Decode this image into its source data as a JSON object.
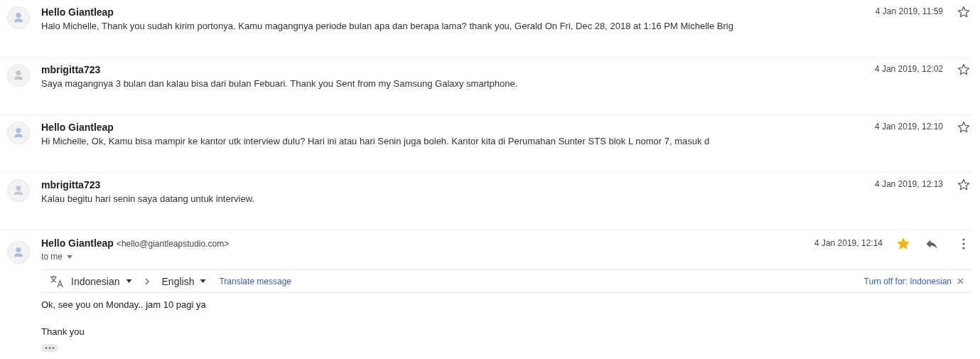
{
  "messages": [
    {
      "sender": "Hello Giantleap",
      "color": "#a8bde3",
      "snippet": "Halo Michelle, Thank you sudah kirim portonya. Kamu magangnya periode bulan apa dan berapa lama? thank you, Gerald On Fri, Dec 28, 2018 at 1:16 PM Michelle Brig",
      "date": "4 Jan 2019, 11:59",
      "starred": false
    },
    {
      "sender": "mbrigitta723",
      "color": "#c4c6ca",
      "snippet": "Saya magangnya 3 bulan dan kalau bisa dari bulan Febuari. Thank you Sent from my Samsung Galaxy smartphone.",
      "date": "4 Jan 2019, 12:02",
      "starred": false
    },
    {
      "sender": "Hello Giantleap",
      "color": "#a8bde3",
      "snippet": "Hi Michelle, Ok, Kamu bisa mampir ke kantor utk interview dulu? Hari ini atau hari Senin juga boleh. Kantor kita di Perumahan Sunter STS blok L nomor 7, masuk d",
      "date": "4 Jan 2019, 12:10",
      "starred": false
    },
    {
      "sender": "mbrigitta723",
      "color": "#c4c6ca",
      "snippet": "Kalau begitu hari senin saya datang untuk interview.",
      "date": "4 Jan 2019, 12:13",
      "starred": false
    }
  ],
  "open_message": {
    "sender": "Hello Giantleap",
    "color": "#a8bde3",
    "address": "<hello@giantleapstudio.com>",
    "recipient": "to me",
    "date": "4 Jan 2019, 12:14",
    "starred": true,
    "translate_bar": {
      "source": "Indonesian",
      "target": "English",
      "action": "Translate message",
      "turn_off": "Turn off for: Indonesian"
    },
    "body": [
      "Ok, see you on Monday.. jam 10 pagi ya",
      "Thank you"
    ]
  }
}
